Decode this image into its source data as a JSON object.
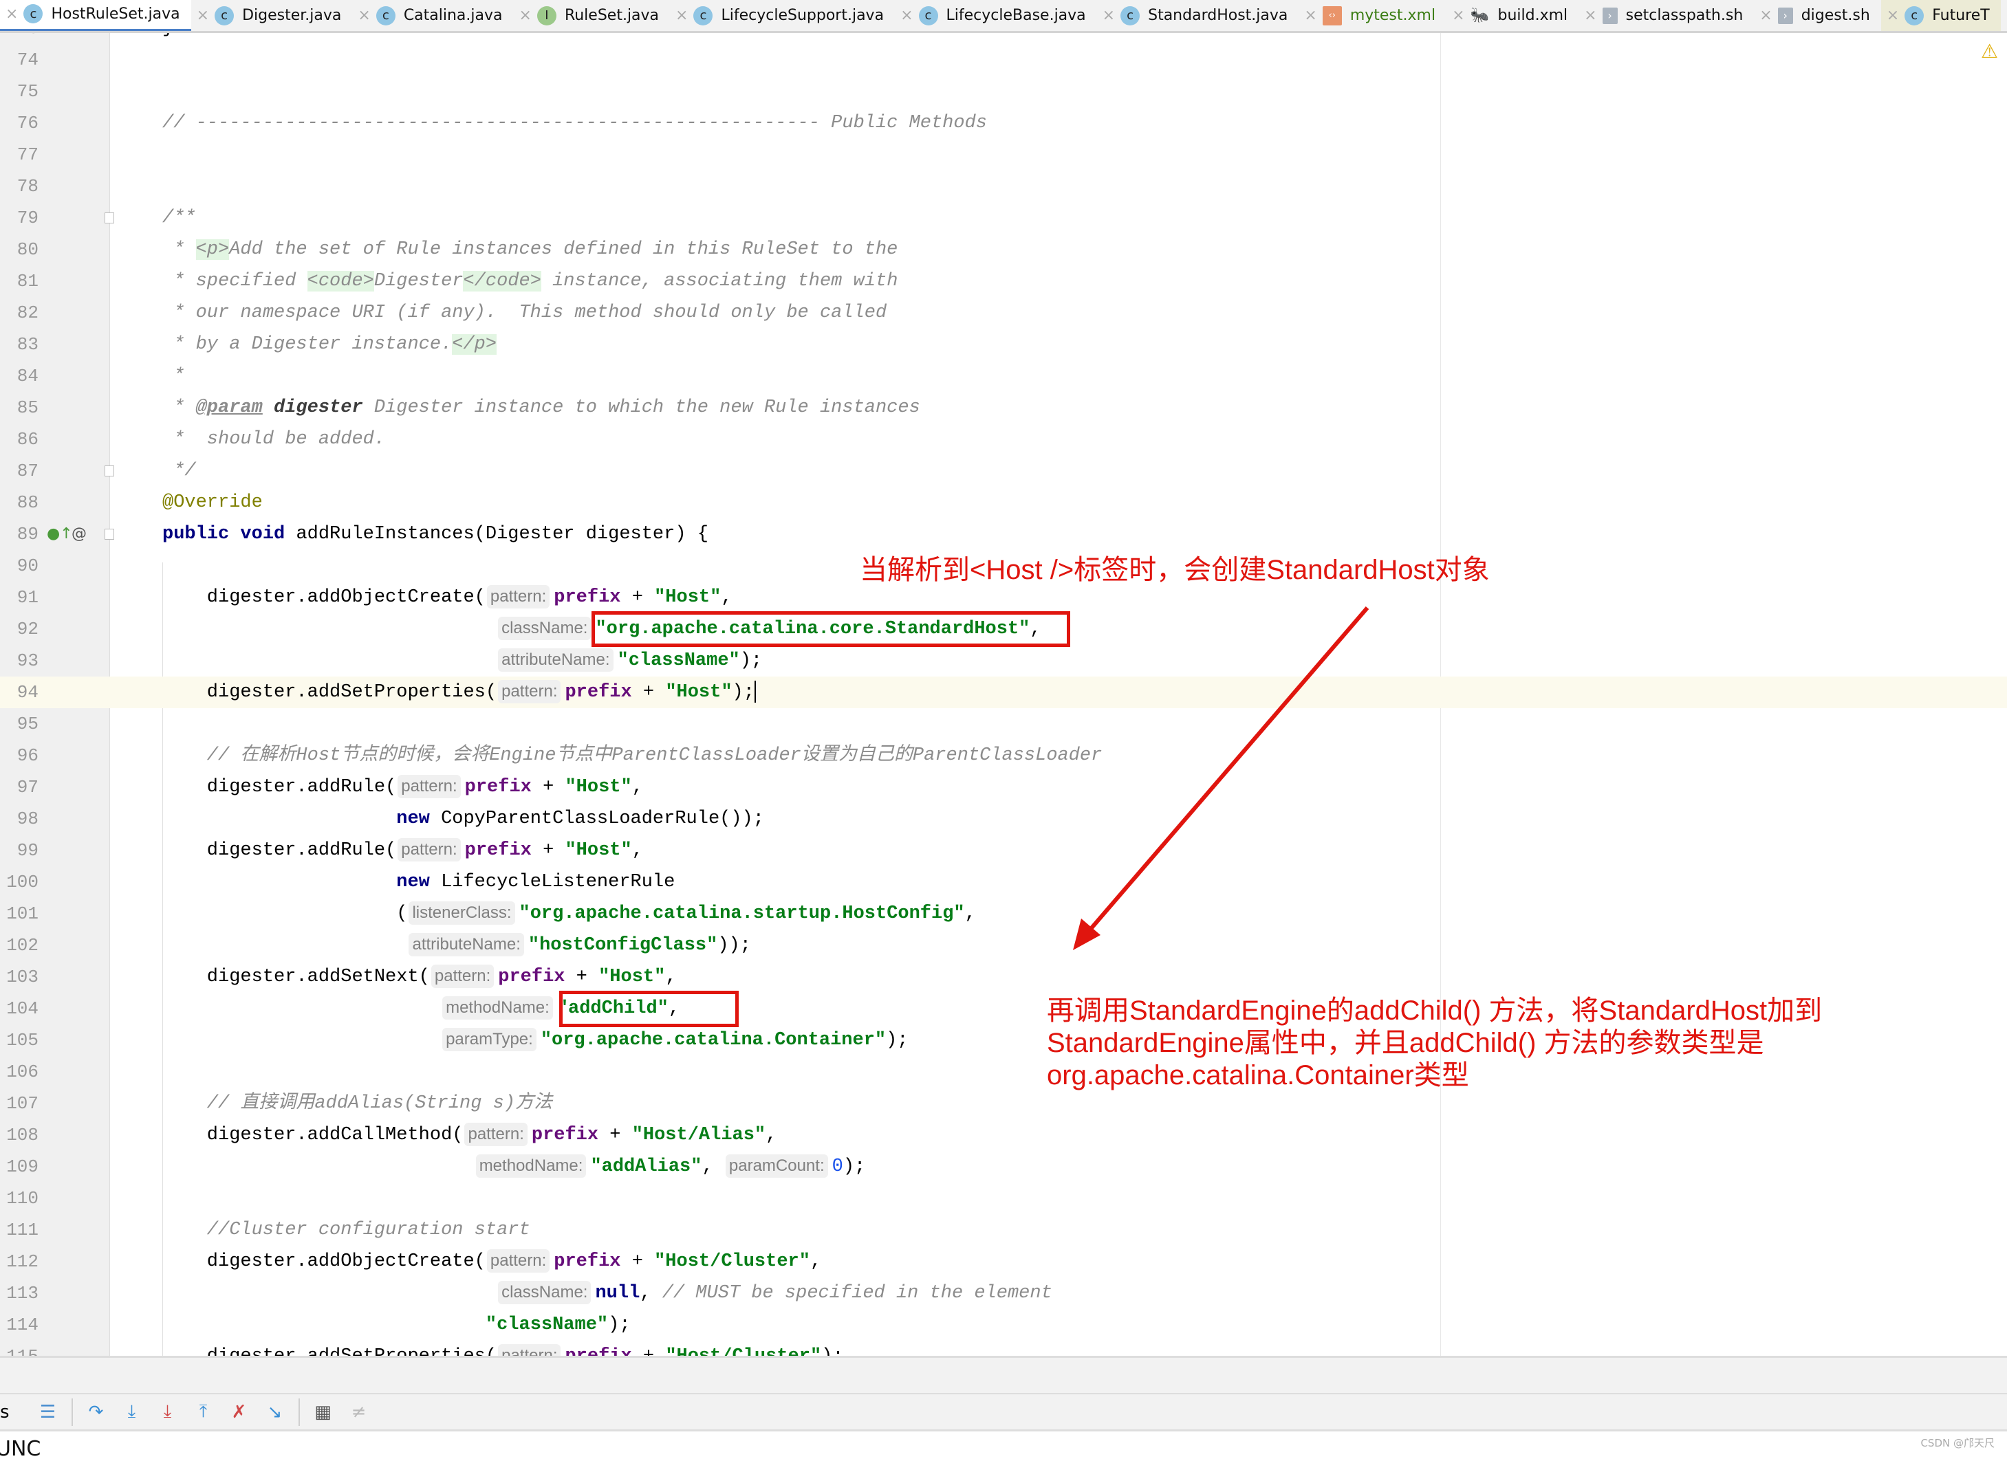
{
  "tabs": [
    {
      "label": "HostRuleSet.java",
      "icon": "class-icon",
      "active": true
    },
    {
      "label": "Digester.java",
      "icon": "class-icon"
    },
    {
      "label": "Catalina.java",
      "icon": "class-icon"
    },
    {
      "label": "RuleSet.java",
      "icon": "interface-icon"
    },
    {
      "label": "LifecycleSupport.java",
      "icon": "class-icon"
    },
    {
      "label": "LifecycleBase.java",
      "icon": "class-icon"
    },
    {
      "label": "StandardHost.java",
      "icon": "class-icon"
    },
    {
      "label": "mytest.xml",
      "icon": "xml-icon",
      "modified": true
    },
    {
      "label": "build.xml",
      "icon": "ant-icon"
    },
    {
      "label": "setclasspath.sh",
      "icon": "shell-icon"
    },
    {
      "label": "digest.sh",
      "icon": "shell-icon"
    },
    {
      "label": "FutureT",
      "icon": "class-icon",
      "last": true
    }
  ],
  "editor": {
    "current_line": 94,
    "lines": [
      {
        "n": 73,
        "t": [
          [
            "p",
            "}"
          ]
        ]
      },
      {
        "n": 74,
        "t": []
      },
      {
        "n": 75,
        "t": []
      },
      {
        "n": 76,
        "t": [
          [
            "cm",
            "// -------------------------------------------------------- Public Methods"
          ]
        ]
      },
      {
        "n": 77,
        "t": []
      },
      {
        "n": 78,
        "t": []
      },
      {
        "n": 79,
        "t": [
          [
            "doc",
            "/**"
          ]
        ]
      },
      {
        "n": 80,
        "t": [
          [
            "doc",
            " * "
          ],
          [
            "tag",
            "<p>"
          ],
          [
            "doc",
            "Add the set of Rule instances defined in this RuleSet to the"
          ]
        ]
      },
      {
        "n": 81,
        "t": [
          [
            "doc",
            " * specified "
          ],
          [
            "tag",
            "<code>"
          ],
          [
            "doc",
            "Digester"
          ],
          [
            "tag",
            "</code>"
          ],
          [
            "doc",
            " instance, associating them with"
          ]
        ]
      },
      {
        "n": 82,
        "t": [
          [
            "doc",
            " * our namespace URI (if any).  This method should only be called"
          ]
        ]
      },
      {
        "n": 83,
        "t": [
          [
            "doc",
            " * by a Digester instance."
          ],
          [
            "tag",
            "</p>"
          ]
        ]
      },
      {
        "n": 84,
        "t": [
          [
            "doc",
            " *"
          ]
        ]
      },
      {
        "n": 85,
        "t": [
          [
            "doc",
            " * "
          ],
          [
            "dtag",
            "@param"
          ],
          [
            "doc",
            " "
          ],
          [
            "dpar",
            "digester"
          ],
          [
            "doc",
            " Digester instance to which the new Rule instances"
          ]
        ]
      },
      {
        "n": 86,
        "t": [
          [
            "doc",
            " *  should be added."
          ]
        ]
      },
      {
        "n": 87,
        "t": [
          [
            "doc",
            " */"
          ]
        ]
      },
      {
        "n": 88,
        "t": [
          [
            "ann",
            "@Override"
          ]
        ]
      },
      {
        "n": 89,
        "t": [
          [
            "kw",
            "public void "
          ],
          [
            "p",
            "addRuleInstances(Digester digester) {"
          ]
        ]
      },
      {
        "n": 90,
        "t": []
      },
      {
        "n": 91,
        "t": [
          [
            "p",
            "    digester.addObjectCreate("
          ],
          [
            "hint",
            "pattern:"
          ],
          [
            "fld",
            "prefix"
          ],
          [
            "p",
            " + "
          ],
          [
            "str",
            "\"Host\""
          ],
          [
            "p",
            ","
          ]
        ]
      },
      {
        "n": 92,
        "t": [
          [
            "p",
            "                              "
          ],
          [
            "hint",
            "className:"
          ],
          [
            "str",
            "\"org.apache.catalina.core.StandardHost\""
          ],
          [
            "p",
            ","
          ]
        ]
      },
      {
        "n": 93,
        "t": [
          [
            "p",
            "                              "
          ],
          [
            "hint",
            "attributeName:"
          ],
          [
            "str",
            "\"className\""
          ],
          [
            "p",
            ");"
          ]
        ]
      },
      {
        "n": 94,
        "t": [
          [
            "p",
            "    digester.addSetProperties("
          ],
          [
            "hint",
            "pattern:"
          ],
          [
            "fld",
            "prefix"
          ],
          [
            "p",
            " + "
          ],
          [
            "str",
            "\"Host\""
          ],
          [
            "p",
            ");"
          ]
        ]
      },
      {
        "n": 95,
        "t": []
      },
      {
        "n": 96,
        "t": [
          [
            "cm",
            "    // 在解析Host节点的时候，会将Engine节点中ParentClassLoader设置为自己的ParentClassLoader"
          ]
        ]
      },
      {
        "n": 97,
        "t": [
          [
            "p",
            "    digester.addRule("
          ],
          [
            "hint",
            "pattern:"
          ],
          [
            "fld",
            "prefix"
          ],
          [
            "p",
            " + "
          ],
          [
            "str",
            "\"Host\""
          ],
          [
            "p",
            ","
          ]
        ]
      },
      {
        "n": 98,
        "t": [
          [
            "p",
            "                     "
          ],
          [
            "kw",
            "new "
          ],
          [
            "p",
            "CopyParentClassLoaderRule());"
          ]
        ]
      },
      {
        "n": 99,
        "t": [
          [
            "p",
            "    digester.addRule("
          ],
          [
            "hint",
            "pattern:"
          ],
          [
            "fld",
            "prefix"
          ],
          [
            "p",
            " + "
          ],
          [
            "str",
            "\"Host\""
          ],
          [
            "p",
            ","
          ]
        ]
      },
      {
        "n": 100,
        "t": [
          [
            "p",
            "                     "
          ],
          [
            "kw",
            "new "
          ],
          [
            "p",
            "LifecycleListenerRule"
          ]
        ]
      },
      {
        "n": 101,
        "t": [
          [
            "p",
            "                     ("
          ],
          [
            "hint",
            "listenerClass:"
          ],
          [
            "str",
            "\"org.apache.catalina.startup.HostConfig\""
          ],
          [
            "p",
            ","
          ]
        ]
      },
      {
        "n": 102,
        "t": [
          [
            "p",
            "                      "
          ],
          [
            "hint",
            "attributeName:"
          ],
          [
            "str",
            "\"hostConfigClass\""
          ],
          [
            "p",
            "));"
          ]
        ]
      },
      {
        "n": 103,
        "t": [
          [
            "p",
            "    digester.addSetNext("
          ],
          [
            "hint",
            "pattern:"
          ],
          [
            "fld",
            "prefix"
          ],
          [
            "p",
            " + "
          ],
          [
            "str",
            "\"Host\""
          ],
          [
            "p",
            ","
          ]
        ]
      },
      {
        "n": 104,
        "t": [
          [
            "p",
            "                         "
          ],
          [
            "hint",
            "methodName:"
          ],
          [
            "str",
            "\"addChild\""
          ],
          [
            "p",
            ","
          ]
        ]
      },
      {
        "n": 105,
        "t": [
          [
            "p",
            "                         "
          ],
          [
            "hint",
            "paramType:"
          ],
          [
            "str",
            "\"org.apache.catalina.Container\""
          ],
          [
            "p",
            ");"
          ]
        ]
      },
      {
        "n": 106,
        "t": []
      },
      {
        "n": 107,
        "t": [
          [
            "cm",
            "    // 直接调用addAlias(String s)方法"
          ]
        ]
      },
      {
        "n": 108,
        "t": [
          [
            "p",
            "    digester.addCallMethod("
          ],
          [
            "hint",
            "pattern:"
          ],
          [
            "fld",
            "prefix"
          ],
          [
            "p",
            " + "
          ],
          [
            "str",
            "\"Host/Alias\""
          ],
          [
            "p",
            ","
          ]
        ]
      },
      {
        "n": 109,
        "t": [
          [
            "p",
            "                            "
          ],
          [
            "hint",
            "methodName:"
          ],
          [
            "str",
            "\"addAlias\""
          ],
          [
            "p",
            ", "
          ],
          [
            "hint",
            "paramCount:"
          ],
          [
            "num",
            "0"
          ],
          [
            "p",
            ");"
          ]
        ]
      },
      {
        "n": 110,
        "t": []
      },
      {
        "n": 111,
        "t": [
          [
            "cm",
            "    //Cluster configuration start"
          ]
        ]
      },
      {
        "n": 112,
        "t": [
          [
            "p",
            "    digester.addObjectCreate("
          ],
          [
            "hint",
            "pattern:"
          ],
          [
            "fld",
            "prefix"
          ],
          [
            "p",
            " + "
          ],
          [
            "str",
            "\"Host/Cluster\""
          ],
          [
            "p",
            ","
          ]
        ]
      },
      {
        "n": 113,
        "t": [
          [
            "p",
            "                              "
          ],
          [
            "hint",
            "className:"
          ],
          [
            "kw",
            "null"
          ],
          [
            "p",
            ", "
          ],
          [
            "cm",
            "// MUST be specified in the element"
          ]
        ]
      },
      {
        "n": 114,
        "t": [
          [
            "p",
            "                             "
          ],
          [
            "str",
            "\"className\""
          ],
          [
            "p",
            ");"
          ]
        ]
      },
      {
        "n": 115,
        "t": [
          [
            "p",
            "    digester.addSetProperties("
          ],
          [
            "hint",
            "pattern:"
          ],
          [
            "fld",
            "prefix"
          ],
          [
            "p",
            " + "
          ],
          [
            "str",
            "\"Host/Cluster\""
          ],
          [
            "p",
            ");"
          ]
        ]
      }
    ]
  },
  "annotations": {
    "note1": "当解析到<Host />标签时，会创建StandardHost对象",
    "note2_lines": [
      "再调用StandardEngine的addChild() 方法，将StandardHost加到",
      "StandardEngine属性中，并且addChild() 方法的参数类型是",
      "org.apache.catalina.Container类型"
    ],
    "color": "#e0150e"
  },
  "bottom": {
    "left_label": "s",
    "console_text": "UNC",
    "watermark": "CSDN @邝天尺"
  }
}
